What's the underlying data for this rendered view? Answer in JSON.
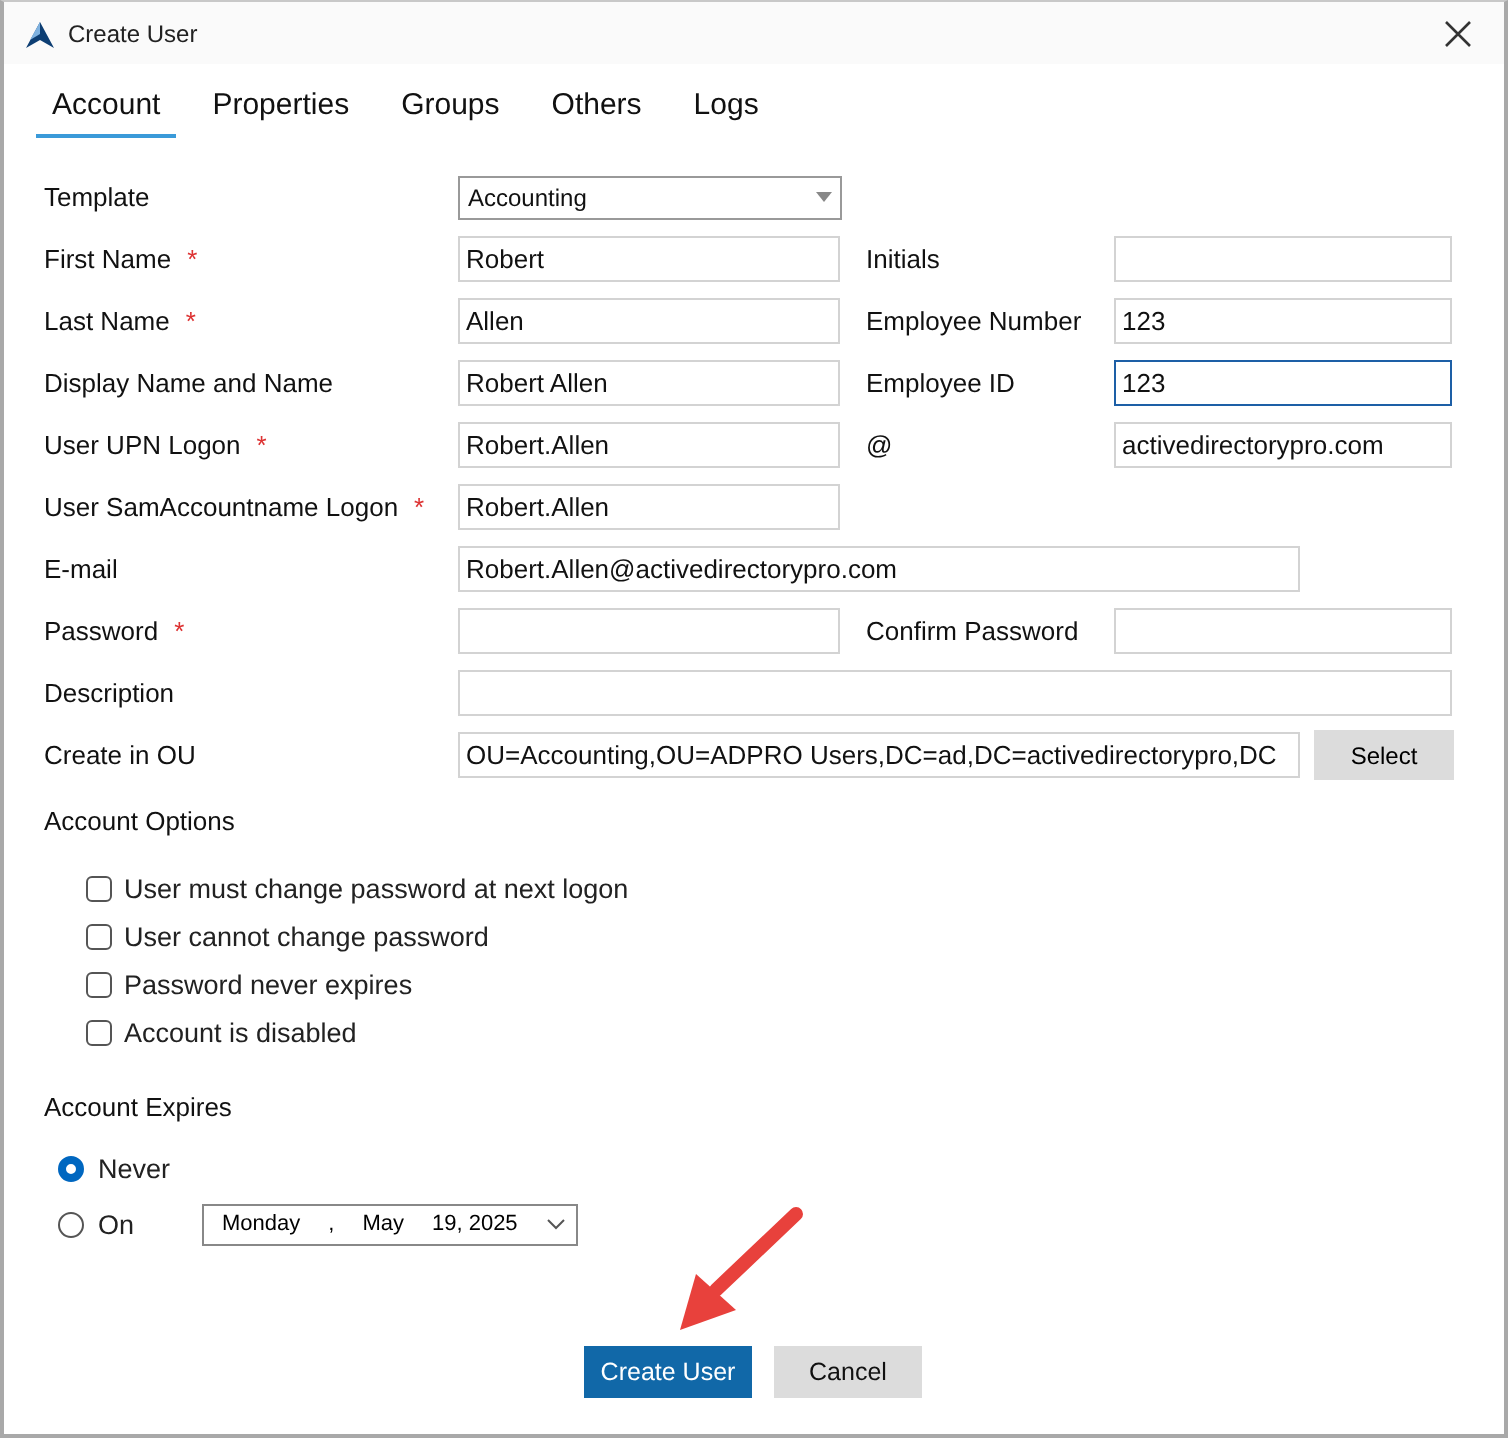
{
  "window": {
    "title": "Create User"
  },
  "tabs": [
    {
      "label": "Account",
      "selected": true
    },
    {
      "label": "Properties",
      "selected": false
    },
    {
      "label": "Groups",
      "selected": false
    },
    {
      "label": "Others",
      "selected": false
    },
    {
      "label": "Logs",
      "selected": false
    }
  ],
  "form": [
    {
      "kind": "dropdown",
      "label": "Template",
      "value": "Accounting"
    },
    {
      "kind": "pair",
      "label": "First Name",
      "required_mark": "*",
      "value": "Robert",
      "right": {
        "label": "Initials",
        "focused": false
      }
    },
    {
      "kind": "pair",
      "label": "Last Name",
      "required_mark": "*",
      "value": "Allen",
      "right": {
        "label": "Employee Number",
        "value": "123",
        "focused": false
      }
    },
    {
      "kind": "pair",
      "label": "Display Name and Name",
      "value": "Robert Allen",
      "right": {
        "label": "Employee ID",
        "value": "123",
        "focused": true
      }
    },
    {
      "kind": "pair",
      "label": "User UPN Logon",
      "required_mark": "*",
      "value": "Robert.Allen",
      "right": {
        "label": "@",
        "value": "activedirectorypro.com",
        "focused": false
      }
    },
    {
      "kind": "text",
      "label": "User SamAccountname Logon",
      "required_mark": "*",
      "value": "Robert.Allen"
    },
    {
      "kind": "medium",
      "label": "E-mail",
      "value": "Robert.Allen@activedirectorypro.com"
    },
    {
      "kind": "pair",
      "label": "Password",
      "required_mark": "*",
      "right": {
        "label": "Confirm Password",
        "focused": false
      }
    },
    {
      "kind": "wide",
      "label": "Description"
    },
    {
      "kind": "browse",
      "label": "Create in OU",
      "value": "OU=Accounting,OU=ADPRO Users,DC=ad,DC=activedirectorypro,DC",
      "button": "Select"
    }
  ],
  "account_options": {
    "title": "Account Options",
    "options": [
      {
        "label": "User must change password at next logon",
        "checked": false
      },
      {
        "label": "User cannot change password",
        "checked": false
      },
      {
        "label": "Password never expires",
        "checked": false
      },
      {
        "label": "Account is disabled",
        "checked": false
      }
    ]
  },
  "account_expires": {
    "title": "Account Expires",
    "choices": [
      {
        "label": "Never",
        "selected": true
      },
      {
        "label": "On",
        "selected": false
      }
    ],
    "date": [
      "Monday",
      ",",
      "May",
      "19, 2025"
    ]
  },
  "buttons": [
    {
      "label": "Create User",
      "kind": "primary"
    },
    {
      "label": "Cancel",
      "kind": "secondary"
    }
  ]
}
